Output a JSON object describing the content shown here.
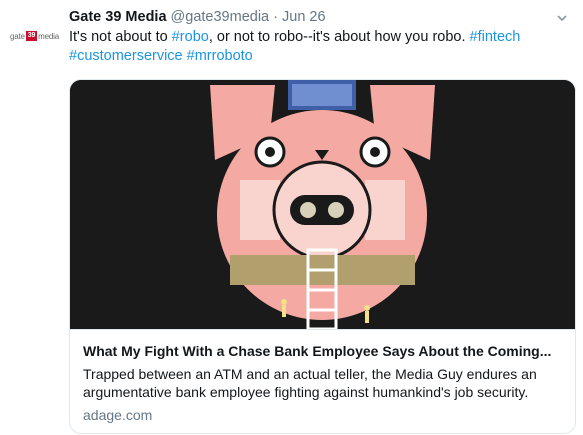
{
  "tweet": {
    "avatar_pre": "gate",
    "avatar_box": "39",
    "avatar_post": "media",
    "name": "Gate 39 Media",
    "handle": "@gate39media",
    "separator": "·",
    "time": "Jun 26",
    "text_parts": [
      {
        "text": "It's not about to ",
        "type": "plain"
      },
      {
        "text": "#robo",
        "type": "hashtag"
      },
      {
        "text": ", or not to robo--it's about how you robo. ",
        "type": "plain"
      },
      {
        "text": "#fintech",
        "type": "hashtag"
      },
      {
        "text": " ",
        "type": "plain"
      },
      {
        "text": "#customerservice",
        "type": "hashtag"
      },
      {
        "text": " ",
        "type": "plain"
      },
      {
        "text": "#mrroboto",
        "type": "hashtag"
      }
    ]
  },
  "card": {
    "title": "What My Fight With a Chase Bank Employee Says About the Coming...",
    "description": "Trapped between an ATM and an actual teller, the Media Guy endures an argumentative bank employee fighting against humankind's job security.",
    "domain": "adage.com"
  },
  "colors": {
    "link": "#1b95e0",
    "secondary": "#657786",
    "robot_pink": "#f4a9a3",
    "robot_dark": "#1a1a1a",
    "robot_blue": "#3f5fa8"
  },
  "icons": {
    "caret": "chevron-down-icon"
  }
}
